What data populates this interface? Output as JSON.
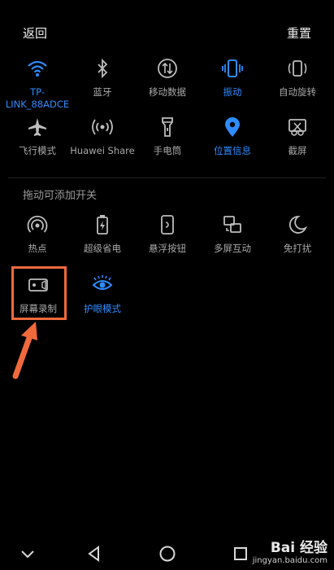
{
  "header": {
    "back_label": "返回",
    "reset_label": "重置"
  },
  "row1": [
    {
      "label": "TP-LINK_88ADCE",
      "icon": "wifi-icon",
      "active": true
    },
    {
      "label": "蓝牙",
      "icon": "bluetooth-icon",
      "active": false
    },
    {
      "label": "移动数据",
      "icon": "mobile-data-icon",
      "active": false
    },
    {
      "label": "振动",
      "icon": "vibrate-icon",
      "active": true
    },
    {
      "label": "自动旋转",
      "icon": "rotate-icon",
      "active": false
    }
  ],
  "row2": [
    {
      "label": "飞行模式",
      "icon": "airplane-icon",
      "active": false
    },
    {
      "label": "Huawei Share",
      "icon": "huawei-share-icon",
      "active": false
    },
    {
      "label": "手电筒",
      "icon": "flashlight-icon",
      "active": false
    },
    {
      "label": "位置信息",
      "icon": "location-icon",
      "active": true
    },
    {
      "label": "截屏",
      "icon": "screenshot-icon",
      "active": false
    }
  ],
  "section": {
    "title": "拖动可添加开关"
  },
  "row3": [
    {
      "label": "热点",
      "icon": "hotspot-icon"
    },
    {
      "label": "超级省电",
      "icon": "battery-saver-icon"
    },
    {
      "label": "悬浮按钮",
      "icon": "floating-button-icon"
    },
    {
      "label": "多屏互动",
      "icon": "multi-screen-icon"
    },
    {
      "label": "免打扰",
      "icon": "do-not-disturb-icon"
    }
  ],
  "row4": [
    {
      "label": "屏幕录制",
      "icon": "screen-record-icon"
    },
    {
      "label": "护眼模式",
      "icon": "eye-comfort-icon"
    }
  ],
  "watermark": {
    "brand": "Bai 经验",
    "sub": "jingyan.baidu.com"
  },
  "colors": {
    "accent": "#2f8cff",
    "highlight": "#f06a3c",
    "background": "#000000"
  }
}
